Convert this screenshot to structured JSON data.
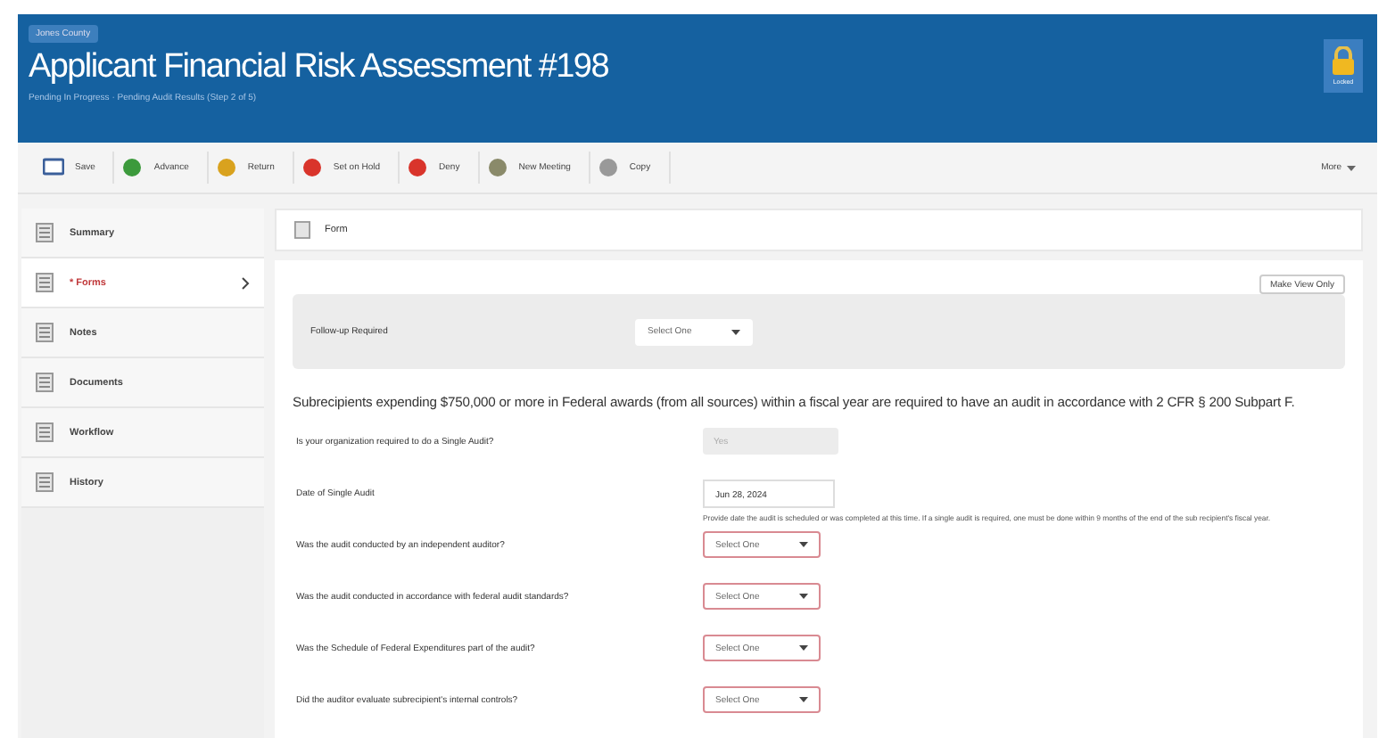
{
  "header": {
    "badge": "Jones County",
    "title": "Applicant Financial Risk Assessment #198",
    "subtitle": "Pending In Progress · Pending Audit Results (Step 2 of 5)",
    "lock_label": "Locked"
  },
  "toolbar": [
    {
      "label": "Save"
    },
    {
      "label": "Advance"
    },
    {
      "label": "Return"
    },
    {
      "label": "Set on Hold"
    },
    {
      "label": "Deny"
    },
    {
      "label": "New Meeting"
    },
    {
      "label": "Copy"
    }
  ],
  "more": "More",
  "sidebar": {
    "items": [
      {
        "label": "Summary",
        "required": false,
        "selected": false
      },
      {
        "label": "* Forms",
        "required": true,
        "selected": true
      },
      {
        "label": "Notes",
        "required": false,
        "selected": false
      },
      {
        "label": "Documents",
        "required": false,
        "selected": false
      },
      {
        "label": "Workflow",
        "required": false,
        "selected": false
      },
      {
        "label": "History",
        "required": false,
        "selected": false
      }
    ]
  },
  "form": {
    "title": "Form",
    "view_only_button": "Make View Only",
    "follow_up": {
      "label": "Follow-up Required",
      "placeholder": "Select One"
    },
    "intro": "Subrecipients expending $750,000 or more in Federal awards (from all sources) within a fiscal year are required to have an audit in accordance with 2 CFR § 200 Subpart F.",
    "fields": [
      {
        "kind": "readonly",
        "label": "Is your organization required to do a Single Audit?",
        "value": "Yes"
      },
      {
        "kind": "date",
        "label": "Date of Single Audit",
        "value": "Jun 28, 2024",
        "help": "Provide date the audit is scheduled or was completed at this time. If a single audit is required, one must be done within 9 months of the end of the sub recipient's fiscal year."
      },
      {
        "kind": "select",
        "label": "Was the audit conducted by an independent auditor?",
        "placeholder": "Select One",
        "invalid": true
      },
      {
        "kind": "select",
        "label": "Was the audit conducted in accordance with federal audit standards?",
        "placeholder": "Select One",
        "invalid": true
      },
      {
        "kind": "select",
        "label": "Was the Schedule of Federal Expenditures part of the audit?",
        "placeholder": "Select One",
        "invalid": true
      },
      {
        "kind": "select",
        "label": "Did the auditor evaluate subrecipient's internal controls?",
        "placeholder": "Select One",
        "invalid": true
      }
    ]
  }
}
